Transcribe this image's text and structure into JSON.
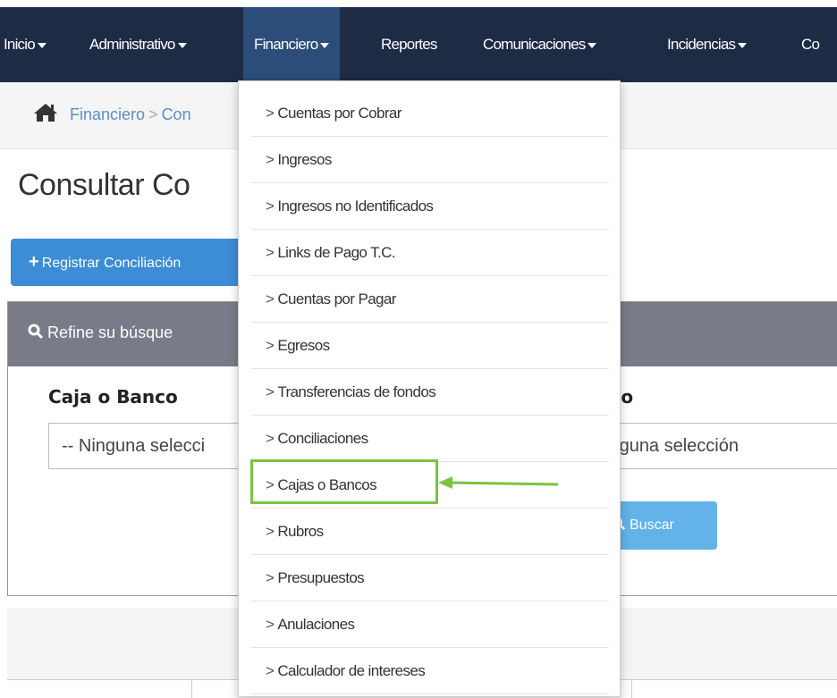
{
  "nav": {
    "items": [
      {
        "label": "Inicio",
        "caret": true
      },
      {
        "label": "Administrativo",
        "caret": true
      },
      {
        "label": "Financiero",
        "caret": true,
        "active": true
      },
      {
        "label": "Reportes",
        "caret": false
      },
      {
        "label": "Comunicaciones",
        "caret": true
      },
      {
        "label": "Incidencias",
        "caret": true
      },
      {
        "label": "Co",
        "caret": false
      }
    ]
  },
  "breadcrumb": {
    "icon": "home-icon",
    "items": [
      "Financiero",
      "Con"
    ],
    "separator": ">"
  },
  "page": {
    "title": "Consultar Co",
    "register_button": "Registrar Conciliación"
  },
  "search_panel": {
    "header": "Refine su búsque",
    "field1_label": "Caja o Banco",
    "field1_value": "-- Ninguna selecci",
    "field2_label": "do",
    "field2_value": "inguna selección",
    "search_button": "Buscar"
  },
  "dropdown": {
    "items": [
      "Cuentas por Cobrar",
      "Ingresos",
      "Ingresos no Identificados",
      "Links de Pago T.C.",
      "Cuentas por Pagar",
      "Egresos",
      "Transferencias de fondos",
      "Conciliaciones",
      "Cajas o Bancos",
      "Rubros",
      "Presupuestos",
      "Anulaciones",
      "Calculador de intereses"
    ],
    "highlighted": "Cajas o Bancos",
    "prefix": ">"
  },
  "colors": {
    "nav_bg": "#1d2b45",
    "nav_active": "#2c4d7a",
    "primary": "#3b8dd6",
    "highlight": "#7cc242"
  }
}
